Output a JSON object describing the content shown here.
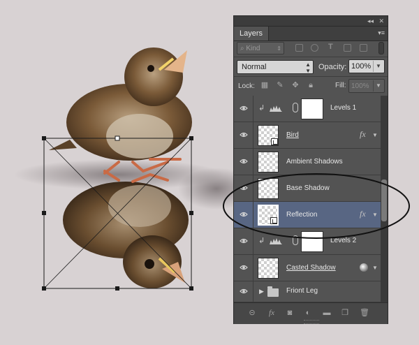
{
  "panel": {
    "tab_label": "Layers",
    "filter": {
      "kind_label": "Kind"
    },
    "blend_mode": "Normal",
    "opacity_label": "Opacity:",
    "opacity_value": "100%",
    "lock_label": "Lock:",
    "fill_label": "Fill:",
    "fill_value": "100%",
    "layers": [
      {
        "name": "Levels 1",
        "type": "adjustment"
      },
      {
        "name": "Bird",
        "type": "smart",
        "fx": "fx"
      },
      {
        "name": "Ambient Shadows",
        "type": "pixel"
      },
      {
        "name": "Base Shadow",
        "type": "pixel"
      },
      {
        "name": "Reflection",
        "type": "smart",
        "fx": "fx",
        "selected": true
      },
      {
        "name": "Levels 2",
        "type": "adjustment"
      },
      {
        "name": "Casted Shadow",
        "type": "pixel"
      },
      {
        "name": "Friont Leg",
        "type": "group"
      }
    ]
  },
  "colors": {
    "canvas_bg": "#d8d2d3",
    "panel_bg": "#535353",
    "selected_row": "#586683"
  }
}
